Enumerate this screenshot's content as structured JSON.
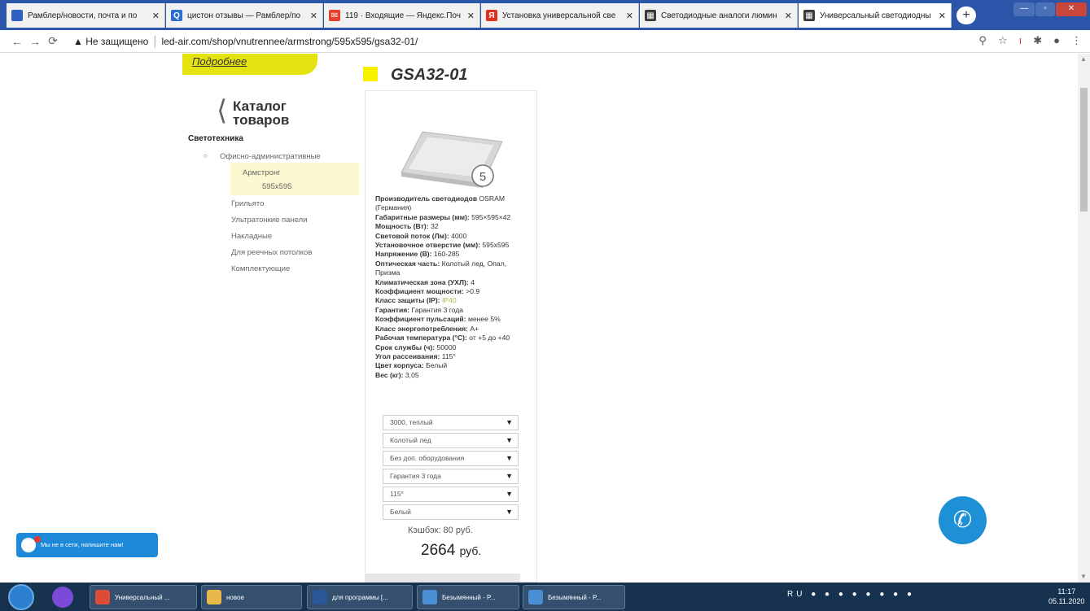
{
  "tabs": [
    {
      "label": "Рамблер/новости, почта и по",
      "favicon_text": "",
      "favicon_color": "#3060c0",
      "active": false
    },
    {
      "label": "цистон отзывы — Рамблер/по",
      "favicon_text": "Q",
      "favicon_color": "#2a6fd0",
      "active": false
    },
    {
      "label": "119 · Входящие — Яндекс.Поч",
      "favicon_text": "✉",
      "favicon_color": "#e5402d",
      "active": false
    },
    {
      "label": "Установка универсальной све",
      "favicon_text": "Я",
      "favicon_color": "#e03020",
      "active": false
    },
    {
      "label": "Светодиодные аналоги люмин",
      "favicon_text": "▦",
      "favicon_color": "#3a3a3a",
      "active": false
    },
    {
      "label": "Универсальный светодиодны",
      "favicon_text": "▦",
      "favicon_color": "#3a3a3a",
      "active": true
    }
  ],
  "browser": {
    "insecure_label": "Не защищено",
    "url": "led-air.com/shop/vnutrennee/armstrong/595x595/gsa32-01/"
  },
  "sidebar": {
    "more_link": "Подробнее",
    "catalog_title": "Каталог товаров",
    "section": "Светотехника",
    "category": "Офисно-административные",
    "subcategory": "Армстронг",
    "selected_size": "595x595",
    "items": [
      "Грильято",
      "Ультратонкие панели",
      "Накладные",
      "Для реечных потолков",
      "Комплектующие"
    ]
  },
  "product": {
    "title": "GSA32-01",
    "badge": "5",
    "specs": [
      {
        "label": "Производитель светодиодов",
        "value": "OSRAM (Германия)"
      },
      {
        "label": "Габаритные размеры (мм):",
        "value": "595×595×42"
      },
      {
        "label": "Мощность (Вт):",
        "value": "32"
      },
      {
        "label": "Световой поток (Лм):",
        "value": "4000"
      },
      {
        "label": "Установочное отверстие (мм):",
        "value": "595x595"
      },
      {
        "label": "Напряжение (В):",
        "value": "160-285"
      },
      {
        "label": "Оптическая часть:",
        "value": "Колотый лед, Опал, Призма"
      },
      {
        "label": "Климатическая зона (УХЛ):",
        "value": "4"
      },
      {
        "label": "Коэффициент мощности:",
        "value": ">0.9"
      },
      {
        "label": "Класс защиты (IP):",
        "value": "IP40"
      },
      {
        "label": "Гарантия:",
        "value": "Гарантия 3 года"
      },
      {
        "label": "Коэффициент пульсаций:",
        "value": "менее 5%"
      },
      {
        "label": "Класс энергопотребления:",
        "value": "A+"
      },
      {
        "label": "Рабочая температура (°C):",
        "value": "от +5 до +40"
      },
      {
        "label": "Срок службы (ч):",
        "value": "50000"
      },
      {
        "label": "Угол рассеивания:",
        "value": "115°"
      },
      {
        "label": "Цвет корпуса:",
        "value": "Белый"
      },
      {
        "label": "Вес (кг):",
        "value": "3,05"
      }
    ],
    "selects": [
      "3000, теплый",
      "Колотый лед",
      "Без доп. оборудования",
      "Гарантия 3 года",
      "115°",
      "Белый"
    ],
    "cashback": "Кэшбэк: 80 руб.",
    "price": "2664",
    "currency": "руб."
  },
  "chat": {
    "label": "Мы не в сети, напишите нам!"
  },
  "taskbar": {
    "buttons": [
      {
        "label": "Универсальный ...",
        "color": "#dd4b39"
      },
      {
        "label": "новое",
        "color": "#e8b84a"
      },
      {
        "label": "для программы [...",
        "color": "#2b5797"
      },
      {
        "label": "Безымянный - Р...",
        "color": "#4a8fd4"
      },
      {
        "label": "Безымянный - Р...",
        "color": "#4a8fd4"
      }
    ],
    "lang": "RU",
    "time": "11:17",
    "date": "05.11.2020"
  }
}
